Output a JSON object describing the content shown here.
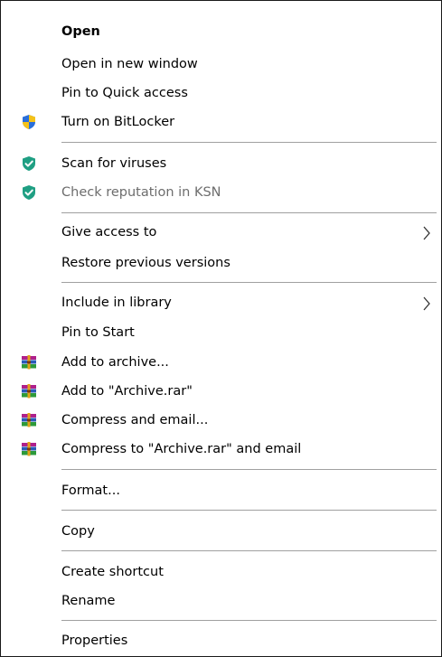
{
  "context_menu": {
    "items": [
      {
        "label": "Open"
      },
      {
        "label": "Open in new window"
      },
      {
        "label": "Pin to Quick access"
      },
      {
        "label": "Turn on BitLocker",
        "icon": "uac-shield-icon"
      },
      {
        "label": "Scan for viruses",
        "icon": "kaspersky-shield-icon"
      },
      {
        "label": "Check reputation in KSN",
        "icon": "kaspersky-shield-icon"
      },
      {
        "label": "Give access to",
        "submenu": true
      },
      {
        "label": "Restore previous versions"
      },
      {
        "label": "Include in library",
        "submenu": true
      },
      {
        "label": "Pin to Start"
      },
      {
        "label": "Add to archive...",
        "icon": "winrar-icon"
      },
      {
        "label": "Add to \"Archive.rar\"",
        "icon": "winrar-icon"
      },
      {
        "label": "Compress and email...",
        "icon": "winrar-icon"
      },
      {
        "label": "Compress to \"Archive.rar\" and email",
        "icon": "winrar-icon"
      },
      {
        "label": "Format..."
      },
      {
        "label": "Copy"
      },
      {
        "label": "Create shortcut"
      },
      {
        "label": "Rename"
      },
      {
        "label": "Properties"
      }
    ]
  },
  "colors": {
    "text": "#000000",
    "disabled_text": "#6d6d6d",
    "separator": "#a0a0a0",
    "kaspersky_green": "#1f9f83",
    "uac_blue": "#2a6fdb",
    "uac_yellow": "#f5c218"
  }
}
